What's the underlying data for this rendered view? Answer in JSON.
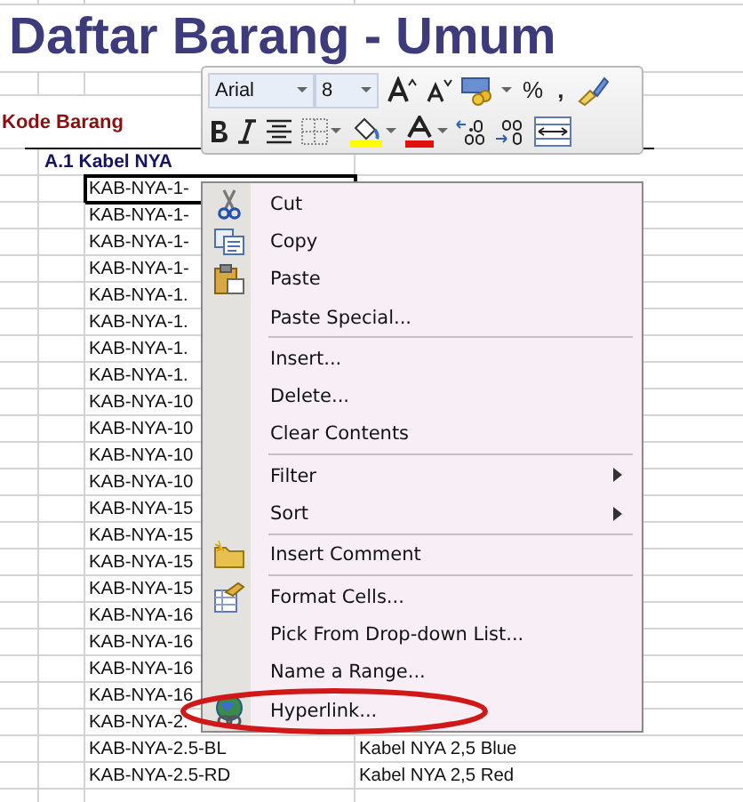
{
  "title": "Daftar Barang - Umum",
  "column_header": "Kode Barang",
  "group": "A.1 Kabel NYA",
  "rows": [
    {
      "code": "KAB-NYA-1-",
      "selected": true
    },
    {
      "code": "KAB-NYA-1-",
      "selected": false
    },
    {
      "code": "KAB-NYA-1-",
      "selected": false
    },
    {
      "code": "KAB-NYA-1-",
      "selected": false
    },
    {
      "code": "KAB-NYA-1.",
      "selected": false
    },
    {
      "code": "KAB-NYA-1.",
      "selected": false
    },
    {
      "code": "KAB-NYA-1.",
      "selected": false
    },
    {
      "code": "KAB-NYA-1.",
      "selected": false
    },
    {
      "code": "KAB-NYA-10",
      "selected": false
    },
    {
      "code": "KAB-NYA-10",
      "selected": false
    },
    {
      "code": "KAB-NYA-10",
      "selected": false
    },
    {
      "code": "KAB-NYA-10",
      "selected": false
    },
    {
      "code": "KAB-NYA-15",
      "selected": false
    },
    {
      "code": "KAB-NYA-15",
      "selected": false
    },
    {
      "code": "KAB-NYA-15",
      "selected": false
    },
    {
      "code": "KAB-NYA-15",
      "selected": false
    },
    {
      "code": "KAB-NYA-16",
      "selected": false
    },
    {
      "code": "KAB-NYA-16",
      "selected": false
    },
    {
      "code": "KAB-NYA-16",
      "selected": false
    },
    {
      "code": "KAB-NYA-16",
      "selected": false
    },
    {
      "code": "KAB-NYA-2.",
      "selected": false
    },
    {
      "code": "KAB-NYA-2.5-BL",
      "name": "Kabel NYA 2,5 Blue",
      "selected": false
    },
    {
      "code": "KAB-NYA-2.5-RD",
      "name": "Kabel NYA 2,5 Red",
      "selected": false
    }
  ],
  "mini_toolbar": {
    "font": "Arial",
    "size": "8",
    "percent": "%",
    "comma": ","
  },
  "context_menu": {
    "items": [
      {
        "label": "Cut",
        "separator_before": false,
        "submenu": false
      },
      {
        "label": "Copy",
        "separator_before": false,
        "submenu": false
      },
      {
        "label": "Paste",
        "separator_before": false,
        "submenu": false
      },
      {
        "label": "Paste Special...",
        "separator_before": false,
        "submenu": false
      },
      {
        "label": "Insert...",
        "separator_before": true,
        "submenu": false
      },
      {
        "label": "Delete...",
        "separator_before": false,
        "submenu": false
      },
      {
        "label": "Clear Contents",
        "separator_before": false,
        "submenu": false
      },
      {
        "label": "Filter",
        "separator_before": true,
        "submenu": true
      },
      {
        "label": "Sort",
        "separator_before": false,
        "submenu": true
      },
      {
        "label": "Insert Comment",
        "separator_before": true,
        "submenu": false
      },
      {
        "label": "Format Cells...",
        "separator_before": true,
        "submenu": false
      },
      {
        "label": "Pick From Drop-down List...",
        "separator_before": false,
        "submenu": false
      },
      {
        "label": "Name a Range...",
        "separator_before": false,
        "submenu": false
      },
      {
        "label": "Hyperlink...",
        "separator_before": false,
        "submenu": false
      }
    ]
  }
}
